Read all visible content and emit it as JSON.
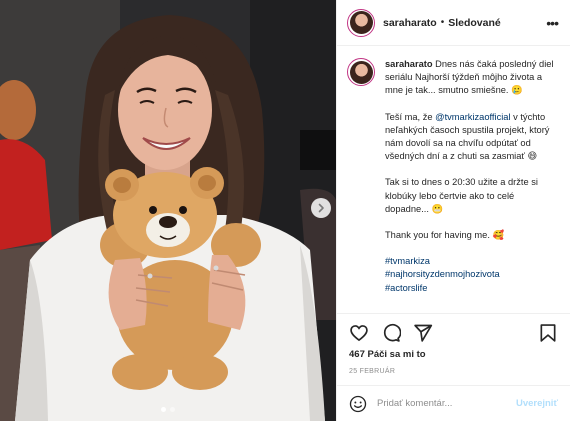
{
  "post": {
    "username": "saraharato",
    "separator": "•",
    "follow_status": "Sledované",
    "more_icon": "more-options-icon",
    "caption": {
      "username": "saraharato",
      "p1": "Dnes nás čaká posledný diel seriálu Najhorší týždeň môjho života a mne je tak... smutno smiešne.",
      "p1_emoji": "🥲",
      "p2_before": "Teší ma, že ",
      "p2_mention": "@tvmarkizaofficial",
      "p2_after": " v týchto neľahkých časoch spustila projekt, ktorý nám dovolí sa na chvíľu odpútať od všedných dní a z chuti sa zasmiať",
      "p2_emoji": "😄",
      "p3": "Tak si to dnes o 20:30 užite a držte si klobúky lebo čertvie ako to celé dopadne...",
      "p3_emoji": "😬",
      "p4": "Thank you for having me.",
      "p4_emoji": "🥰",
      "hashtags": [
        "#tvmarkiza",
        "#najhorsityzdenmojhozivota",
        "#actorslife"
      ]
    },
    "likes_count": "467",
    "likes_label": "Páči sa mi to",
    "date": "25 FEBRUÁR",
    "comment_placeholder": "Pridať komentár...",
    "post_button": "Uverejniť",
    "carousel": {
      "total": 2,
      "active": 0
    }
  },
  "colors": {
    "link": "#00376b",
    "secondary_text": "#8e8e8e",
    "disabled_blue": "#b2dffc",
    "story_ring": "#c13584"
  },
  "icons": [
    "heart-icon",
    "comment-icon",
    "share-icon",
    "bookmark-icon",
    "emoji-icon",
    "next-arrow-icon"
  ]
}
